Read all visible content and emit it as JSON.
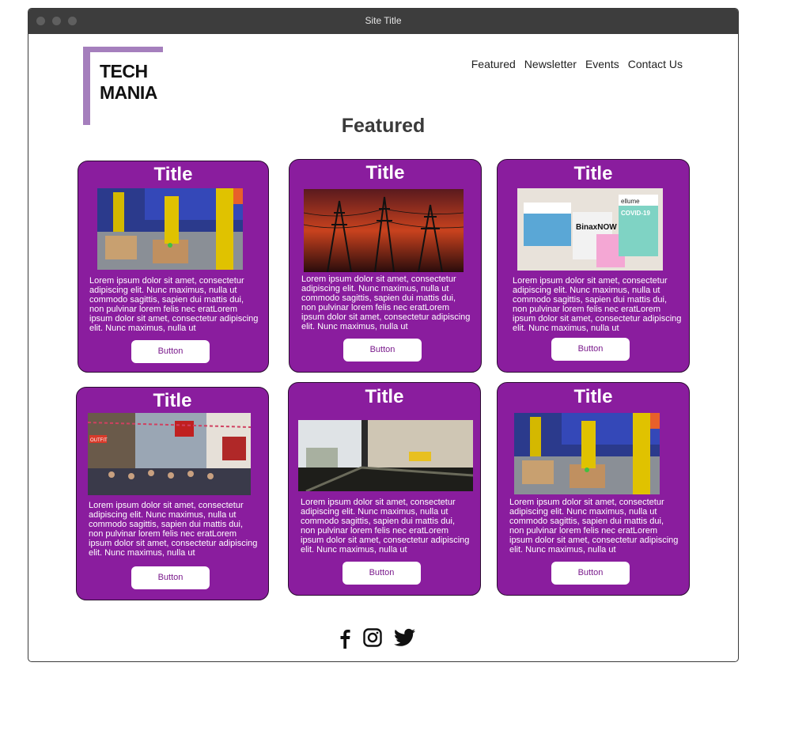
{
  "window": {
    "title": "Site Title"
  },
  "logo": {
    "line1": "TECH",
    "line2": "MANIA"
  },
  "nav": {
    "items": [
      "Featured",
      "Newsletter",
      "Events",
      "Contact Us"
    ]
  },
  "featured": {
    "heading": "Featured"
  },
  "cards": [
    {
      "title": "Title",
      "text": "Lorem ipsum dolor sit amet, consectetur adipiscing elit. Nunc maximus, nulla ut commodo sagittis, sapien dui mattis dui, non pulvinar lorem felis nec eratLorem ipsum dolor sit amet, consectetur adipiscing elit. Nunc maximus, nulla ut",
      "button": "Button",
      "image": "robot-arm-warehouse"
    },
    {
      "title": "Title",
      "text": "Lorem ipsum dolor sit amet, consectetur adipiscing elit. Nunc maximus, nulla ut commodo sagittis, sapien dui mattis dui, non pulvinar lorem felis nec eratLorem ipsum dolor sit amet, consectetur adipiscing elit. Nunc maximus, nulla ut",
      "button": "Button",
      "image": "power-lines-sunset"
    },
    {
      "title": "Title",
      "text": "Lorem ipsum dolor sit amet, consectetur adipiscing elit. Nunc maximus, nulla ut commodo sagittis, sapien dui mattis dui, non pulvinar lorem felis nec eratLorem ipsum dolor sit amet, consectetur adipiscing elit. Nunc maximus, nulla ut",
      "button": "Button",
      "image": "covid-test-kits"
    },
    {
      "title": "Title",
      "text": "Lorem ipsum dolor sit amet, consectetur adipiscing elit. Nunc maximus, nulla ut commodo sagittis, sapien dui mattis dui, non pulvinar lorem felis nec eratLorem ipsum dolor sit amet, consectetur adipiscing elit. Nunc maximus, nulla ut",
      "button": "Button",
      "image": "busy-street"
    },
    {
      "title": "Title",
      "text": "Lorem ipsum dolor sit amet, consectetur adipiscing elit. Nunc maximus, nulla ut commodo sagittis, sapien dui mattis dui, non pulvinar lorem felis nec eratLorem ipsum dolor sit amet, consectetur adipiscing elit. Nunc maximus, nulla ut",
      "button": "Button",
      "image": "cafe-window"
    },
    {
      "title": "Title",
      "text": "Lorem ipsum dolor sit amet, consectetur adipiscing elit. Nunc maximus, nulla ut commodo sagittis, sapien dui mattis dui, non pulvinar lorem felis nec eratLorem ipsum dolor sit amet, consectetur adipiscing elit. Nunc maximus, nulla ut",
      "button": "Button",
      "image": "robot-arm-warehouse"
    }
  ],
  "test_kit_labels": {
    "brand1": "BinaxNOW",
    "brand2": "ellume",
    "brand3": "COVID-19"
  },
  "street_sign": "OUTFIT",
  "social": {
    "icons": [
      "facebook-icon",
      "instagram-icon",
      "twitter-icon"
    ]
  },
  "colors": {
    "card_purple": "#8a1d9e",
    "logo_accent": "#a57fbd",
    "button_text": "#7a1a8c",
    "titlebar": "#3d3d3d"
  }
}
